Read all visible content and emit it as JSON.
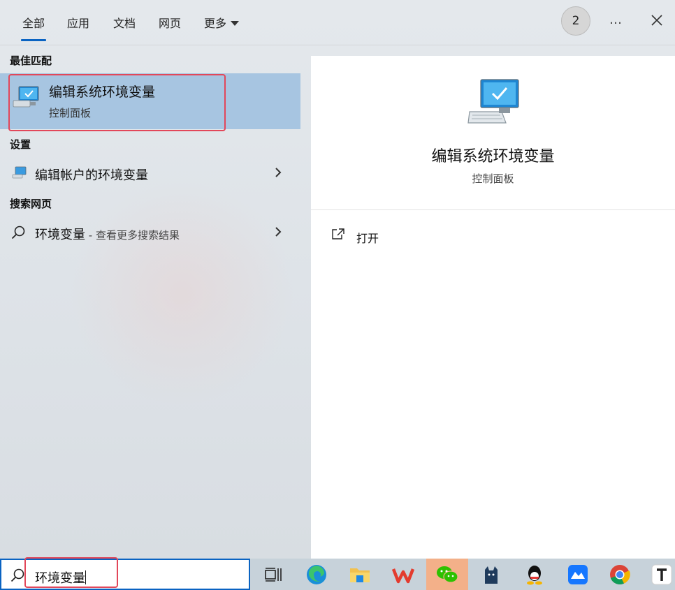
{
  "tabs": [
    {
      "label": "全部"
    },
    {
      "label": "应用"
    },
    {
      "label": "文档"
    },
    {
      "label": "网页"
    },
    {
      "label": "更多"
    }
  ],
  "badge_count": "2",
  "more_icon": "…",
  "sections": {
    "best_match": "最佳匹配",
    "settings": "设置",
    "web_search": "搜索网页"
  },
  "best_match": {
    "title": "编辑系统环境变量",
    "subtitle": "控制面板",
    "icon": "monitor-check-icon"
  },
  "settings_item": {
    "label": "编辑帐户的环境变量",
    "icon": "settings-monitor-icon"
  },
  "web_item": {
    "label": "环境变量",
    "suffix": " - 查看更多搜索结果",
    "icon": "search-icon"
  },
  "detail": {
    "title": "编辑系统环境变量",
    "subtitle": "控制面板",
    "open_label": "打开"
  },
  "search": {
    "value": "环境变量"
  },
  "taskbar": {
    "apps": [
      "task-view-icon",
      "edge-icon",
      "file-explorer-icon",
      "wps-icon",
      "wechat-icon",
      "cat-app-icon",
      "qq-icon",
      "feishu-icon",
      "chrome-icon",
      "typora-icon"
    ]
  },
  "colors": {
    "accent": "#0a63c2",
    "selection": "#a7c5e1",
    "highlight_border": "#e2475a"
  }
}
